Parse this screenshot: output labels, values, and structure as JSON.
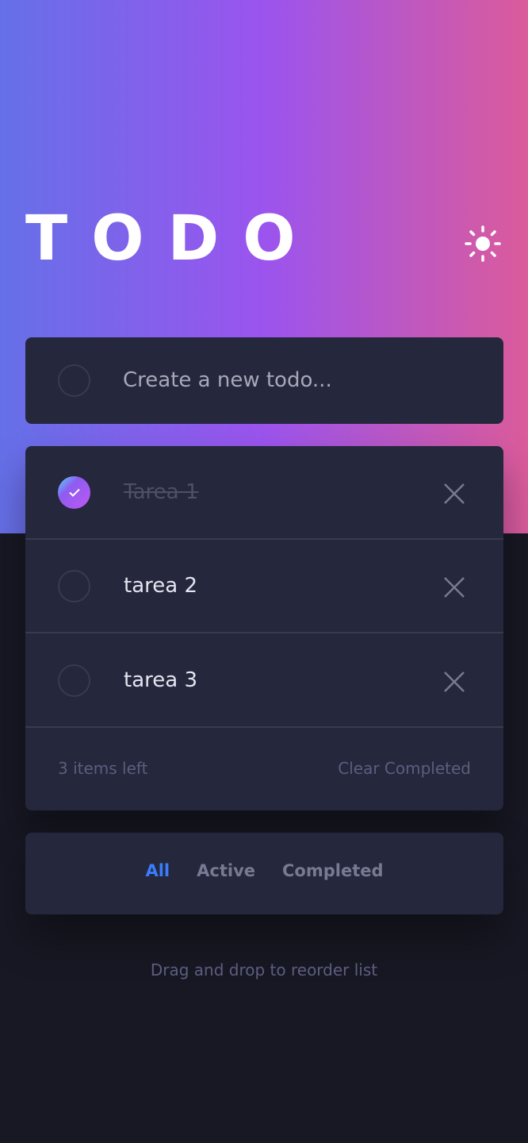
{
  "header": {
    "title": "TODO",
    "theme_icon": "sun-icon"
  },
  "new_todo": {
    "placeholder": "Create a new todo..."
  },
  "todos": [
    {
      "text": "Tarea 1",
      "completed": true
    },
    {
      "text": "tarea 2",
      "completed": false
    },
    {
      "text": "tarea 3",
      "completed": false
    }
  ],
  "footer": {
    "items_left": "3 items left",
    "clear": "Clear Completed"
  },
  "filters": {
    "all": "All",
    "active": "Active",
    "completed": "Completed",
    "selected": "All"
  },
  "hint": "Drag and drop to reorder list",
  "colors": {
    "gradient_start": "#6570e8",
    "gradient_mid": "#9b54ee",
    "gradient_end": "#db5b9b",
    "card": "#25273c",
    "background": "#181824",
    "accent": "#3a7cfd"
  }
}
